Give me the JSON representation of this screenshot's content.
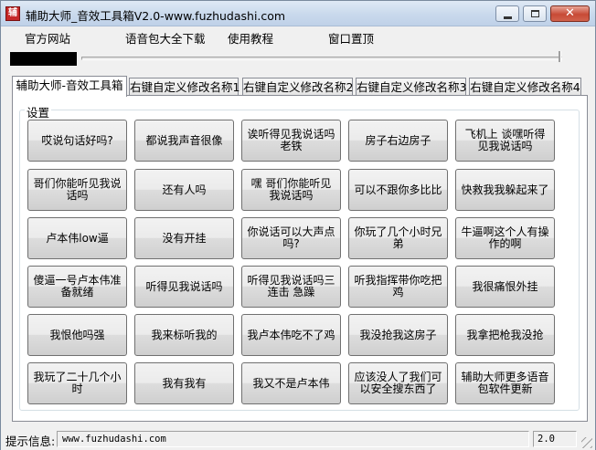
{
  "window": {
    "title": "辅助大师_音效工具箱V2.0-www.fuzhudashi.com",
    "app_icon": "app-icon",
    "app_icon_glyph": "辅",
    "controls": [
      "minimize-icon",
      "maximize-icon",
      "close-icon"
    ]
  },
  "menu": {
    "items": [
      "官方网站",
      "语音包大全下载",
      "使用教程",
      "窗口置顶"
    ]
  },
  "tabs": [
    "辅助大师-音效工具箱",
    "右键自定义修改名称1",
    "右键自定义修改名称2",
    "右键自定义修改名称3",
    "右键自定义修改名称4"
  ],
  "group": {
    "label": "设置"
  },
  "buttons": [
    "哎说句话好吗?",
    "都说我声音很像",
    "诶听得见我说话吗老铁",
    "房子右边房子",
    "飞机上 谈嘿听得见我说话吗",
    "哥们你能听见我说话吗",
    "还有人吗",
    "嘿 哥们你能听见我说话吗",
    "可以不跟你多比比",
    "快救我我躲起来了",
    "卢本伟low逼",
    "没有开挂",
    "你说话可以大声点吗?",
    "你玩了几个小时兄弟",
    "牛逼啊这个人有操作的啊",
    "傻逼一号卢本伟准备就绪",
    "听得见我说话吗",
    "听得见我说话吗三连击 急躁",
    "听我指挥带你吃把鸡",
    "我很痛恨外挂",
    "我恨他吗强",
    "我来标听我的",
    "我卢本伟吃不了鸡",
    "我没抢我这房子",
    "我拿把枪我没抢",
    "我玩了二十几个小时",
    "我有我有",
    "我又不是卢本伟",
    "应该没人了我们可以安全搜东西了",
    "辅助大师更多语音包软件更新"
  ],
  "status": {
    "label": "提示信息:",
    "message": "www.fuzhudashi.com",
    "version": "2.0"
  }
}
